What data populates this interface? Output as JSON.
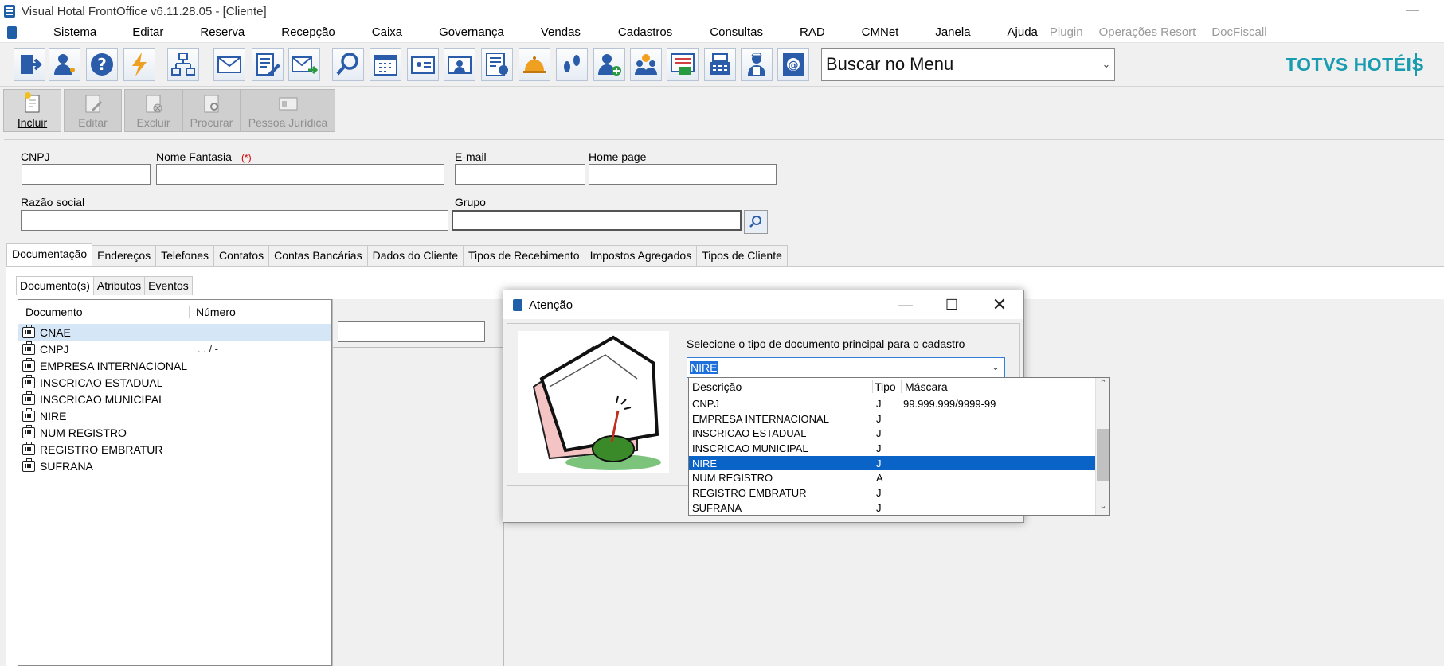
{
  "window": {
    "title": "Visual Hotal FrontOffice v6.11.28.05 - [Cliente]",
    "minimize": "—"
  },
  "menu": {
    "items": [
      "Sistema",
      "Editar",
      "Reserva",
      "Recepção",
      "Caixa",
      "Governança",
      "Vendas",
      "Cadastros",
      "Consultas",
      "RAD",
      "CMNet",
      "Janela",
      "Ajuda"
    ],
    "disabled_items": [
      "Plugin",
      "Operações Resort",
      "DocFiscall"
    ]
  },
  "toolbar": {
    "search_menu": "Buscar no Menu",
    "brand": "TOTVS HOTÉIS",
    "icons": [
      "exit-icon",
      "user-key-icon",
      "help-icon",
      "lightning-icon",
      "network-icon",
      "mail-icon",
      "edit-list-icon",
      "mail-send-icon",
      "search-icon",
      "calendar-icon",
      "card-icon",
      "id-card-icon",
      "guest-list-icon",
      "bell-icon",
      "footprints-icon",
      "add-user-icon",
      "group-icon",
      "invoice-icon",
      "cash-register-icon",
      "maid-icon",
      "contact-card-icon"
    ]
  },
  "actions": {
    "incluir": "Incluir",
    "editar": "Editar",
    "excluir": "Excluir",
    "procurar": "Procurar",
    "pessoa_juridica": "Pessoa Jurídica"
  },
  "form": {
    "cnpj_label": "CNPJ",
    "nome_fantasia_label": "Nome Fantasia",
    "required_marker": "(*)",
    "email_label": "E-mail",
    "homepage_label": "Home page",
    "razao_social_label": "Razão social",
    "grupo_label": "Grupo"
  },
  "tabs": [
    "Documentação",
    "Endereços",
    "Telefones",
    "Contatos",
    "Contas Bancárias",
    "Dados do Cliente",
    "Tipos de Recebimento",
    "Impostos Agregados",
    "Tipos de Cliente"
  ],
  "subtabs": [
    "Documento(s)",
    "Atributos",
    "Eventos"
  ],
  "documents": {
    "header": {
      "documento": "Documento",
      "numero": "Número"
    },
    "rows": [
      {
        "name": "CNAE",
        "number": ""
      },
      {
        "name": "CNPJ",
        "number": ". . / -"
      },
      {
        "name": "EMPRESA INTERNACIONAL",
        "number": ""
      },
      {
        "name": "INSCRICAO ESTADUAL",
        "number": ""
      },
      {
        "name": "INSCRICAO MUNICIPAL",
        "number": ""
      },
      {
        "name": "NIRE",
        "number": ""
      },
      {
        "name": "NUM REGISTRO",
        "number": ""
      },
      {
        "name": "REGISTRO EMBRATUR",
        "number": ""
      },
      {
        "name": "SUFRANA",
        "number": ""
      }
    ]
  },
  "dialog": {
    "title": "Atenção",
    "message": "Selecione o tipo de documento principal para o cadastro",
    "selected": "NIRE",
    "header": {
      "descricao": "Descrição",
      "tipo": "Tipo",
      "mascara": "Máscara"
    },
    "rows": [
      {
        "descricao": "CNPJ",
        "tipo": "J",
        "mascara": "99.999.999/9999-99"
      },
      {
        "descricao": "EMPRESA INTERNACIONAL",
        "tipo": "J",
        "mascara": ""
      },
      {
        "descricao": "INSCRICAO ESTADUAL",
        "tipo": "J",
        "mascara": ""
      },
      {
        "descricao": "INSCRICAO MUNICIPAL",
        "tipo": "J",
        "mascara": ""
      },
      {
        "descricao": "NIRE",
        "tipo": "J",
        "mascara": ""
      },
      {
        "descricao": "NUM REGISTRO",
        "tipo": "A",
        "mascara": ""
      },
      {
        "descricao": "REGISTRO EMBRATUR",
        "tipo": "J",
        "mascara": ""
      },
      {
        "descricao": "SUFRANA",
        "tipo": "J",
        "mascara": ""
      }
    ]
  },
  "colors": {
    "brand": "#1a9cb0",
    "selection": "#0a64c8",
    "required": "#d40000"
  }
}
